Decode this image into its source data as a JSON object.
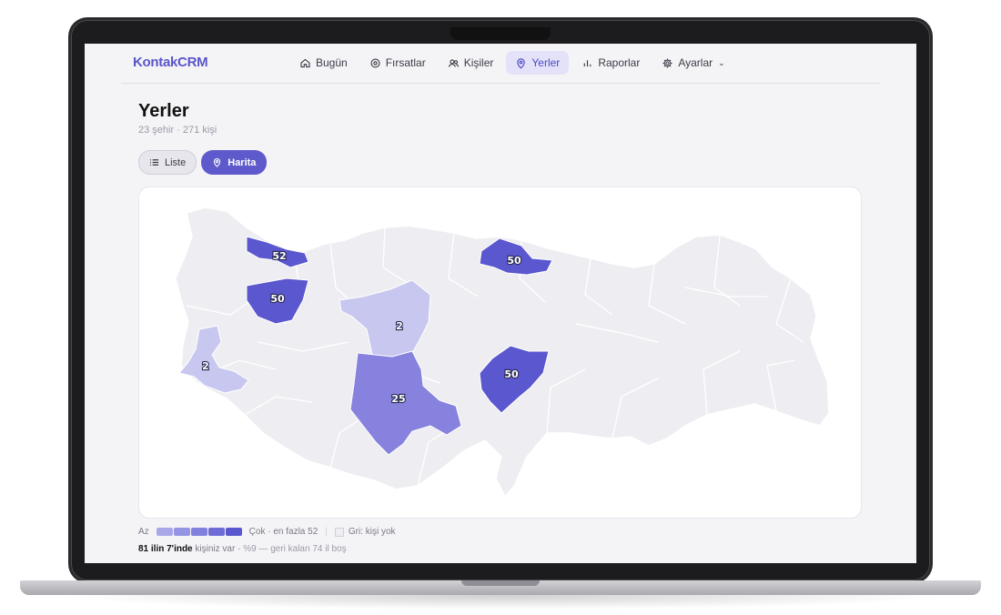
{
  "app": {
    "logo": "KontakCRM"
  },
  "nav": [
    {
      "label": "Bugün",
      "icon": "home-icon"
    },
    {
      "label": "Fırsatlar",
      "icon": "target-icon"
    },
    {
      "label": "Kişiler",
      "icon": "users-icon"
    },
    {
      "label": "Yerler",
      "icon": "location-pin-icon",
      "active": true
    },
    {
      "label": "Raporlar",
      "icon": "bar-chart-icon"
    },
    {
      "label": "Ayarlar",
      "icon": "gear-icon",
      "dropdown": true
    }
  ],
  "page": {
    "title": "Yerler",
    "subtitle": "23 şehir · 271 kişi"
  },
  "view_toggle": {
    "list_label": "Liste",
    "map_label": "Harita",
    "selected": "Harita"
  },
  "map": {
    "regions": [
      {
        "value": "52",
        "color": "#5a57cf"
      },
      {
        "value": "50",
        "color": "#5a57cf"
      },
      {
        "value": "50",
        "color": "#5a57cf"
      },
      {
        "value": "2",
        "color": "#c7c7f0"
      },
      {
        "value": "2",
        "color": "#c7c7f0"
      },
      {
        "value": "25",
        "color": "#8782de"
      },
      {
        "value": "50",
        "color": "#5a57cf"
      }
    ],
    "empty_color": "#eeeef2"
  },
  "legend": {
    "low": "Az",
    "high": "Çok · en fazla 52",
    "empty": "Gri: kişi yok",
    "scale_colors": [
      "#a9a7ea",
      "#9593e4",
      "#8280de",
      "#6f6cd7",
      "#5a57cf"
    ]
  },
  "summary": {
    "strong": "81 ilin 7'inde",
    "text": " kişiniz var · ",
    "pct": "%9 — geri kalan 74 il boş"
  },
  "colors": {
    "accent": "#5f5acb"
  }
}
